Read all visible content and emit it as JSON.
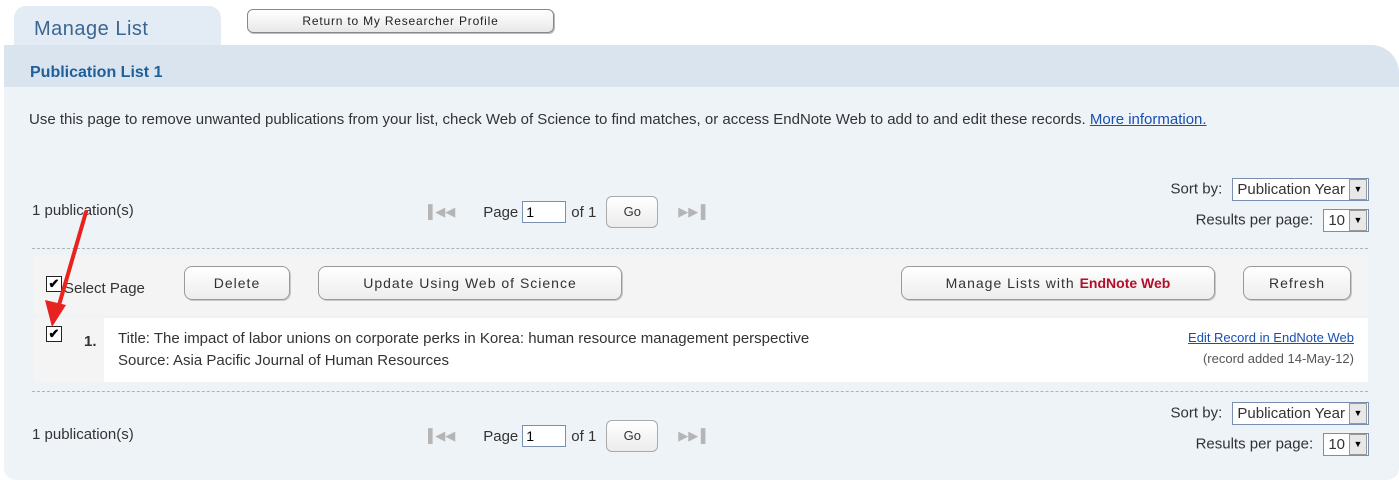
{
  "tab": {
    "label": "Manage List"
  },
  "return_button": {
    "label": "Return to My Researcher Profile"
  },
  "panel": {
    "title": "Publication List 1",
    "intro_text": "Use this page to remove unwanted publications from your list, check Web of Science to find matches, or access EndNote Web to add to and edit these records.",
    "more_info_link": "More information."
  },
  "top_bar": {
    "count": "1 publication(s)",
    "page_label": "Page",
    "page_value": "1",
    "of_label": "of 1",
    "go_label": "Go",
    "sort_label": "Sort by:",
    "sort_value": "Publication Year",
    "results_label": "Results per page:",
    "results_value": "10"
  },
  "toolbar": {
    "select_page_label": "Select Page",
    "select_page_checked": true,
    "delete_label": "Delete",
    "update_label": "Update Using Web of Science",
    "manage_prefix": "Manage Lists with",
    "manage_brand": "EndNote Web",
    "refresh_label": "Refresh"
  },
  "records": [
    {
      "checked": true,
      "number": "1.",
      "title": "Title: The impact of labor unions on corporate perks in Korea: human resource management perspective",
      "source_label": "Source: ",
      "source": "Asia Pacific Journal of Human Resources",
      "edit_link": "Edit Record in EndNote Web",
      "added": "(record added 14-May-12)"
    }
  ],
  "bottom_bar": {
    "count": "1 publication(s)",
    "page_label": "Page",
    "page_value": "1",
    "of_label": "of 1",
    "go_label": "Go",
    "sort_label": "Sort by:",
    "sort_value": "Publication Year",
    "results_label": "Results per page:",
    "results_value": "10"
  },
  "colors": {
    "panel_bg": "#eef3f8",
    "header_bg": "#d9e4ef",
    "title_blue": "#1f5f9a",
    "link_blue": "#1a4fb0",
    "annotation_arrow": "#e8221f",
    "endnote_red": "#b0102a"
  },
  "icons": {
    "first_page": "first-page-icon",
    "prev_page": "prev-page-icon",
    "next_page": "next-page-icon",
    "last_page": "last-page-icon"
  }
}
